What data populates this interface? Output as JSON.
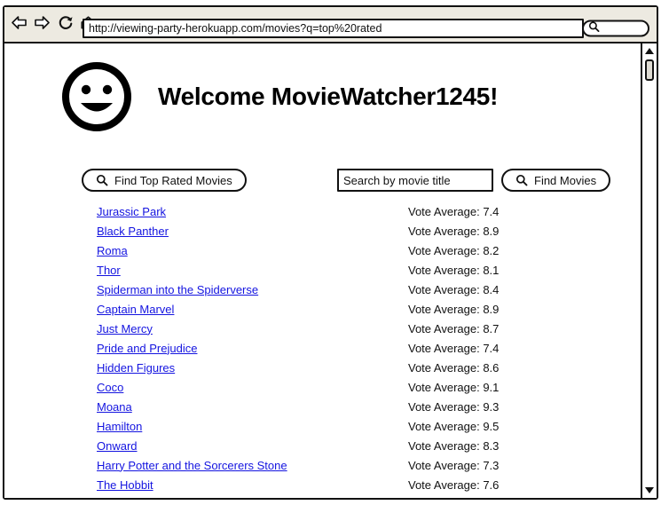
{
  "browser": {
    "back_icon": "back-arrow-icon",
    "forward_icon": "forward-arrow-icon",
    "reload_icon": "reload-icon",
    "home_icon": "home-icon",
    "url": "http://viewing-party-herokuapp.com/movies?q=top%20rated",
    "search_value": "",
    "search_placeholder": "",
    "search_icon": "search-icon"
  },
  "page": {
    "avatar_icon": "smiley-face-icon",
    "welcome_title": "Welcome MovieWatcher1245!"
  },
  "controls": {
    "top_rated_button": {
      "label": "Find Top Rated Movies",
      "icon": "search-icon"
    },
    "search_input": {
      "value": "",
      "placeholder": "Search by movie title"
    },
    "find_movies_button": {
      "label": "Find Movies",
      "icon": "search-icon"
    }
  },
  "colors": {
    "link": "#1414E0",
    "chrome_background": "#EDEAE1",
    "outline": "#111111",
    "page_background": "#FFFFFF"
  },
  "movies": [
    {
      "title": "Jurassic Park",
      "vote": "Vote Average: 7.4"
    },
    {
      "title": "Black Panther",
      "vote": "Vote Average: 8.9"
    },
    {
      "title": "Roma",
      "vote": "Vote Average: 8.2"
    },
    {
      "title": "Thor",
      "vote": "Vote Average: 8.1"
    },
    {
      "title": "Spiderman into the Spiderverse",
      "vote": "Vote Average: 8.4"
    },
    {
      "title": "Captain Marvel",
      "vote": "Vote Average: 8.9"
    },
    {
      "title": "Just Mercy",
      "vote": "Vote Average: 8.7"
    },
    {
      "title": "Pride and Prejudice",
      "vote": "Vote Average: 7.4"
    },
    {
      "title": "Hidden Figures",
      "vote": "Vote Average: 8.6"
    },
    {
      "title": "Coco",
      "vote": "Vote Average: 9.1"
    },
    {
      "title": "Moana",
      "vote": "Vote Average: 9.3"
    },
    {
      "title": "Hamilton",
      "vote": "Vote Average: 9.5"
    },
    {
      "title": "Onward",
      "vote": "Vote Average: 8.3"
    },
    {
      "title": "Harry Potter and the Sorcerers Stone",
      "vote": "Vote Average: 7.3"
    },
    {
      "title": "The Hobbit",
      "vote": "Vote Average: 7.6"
    }
  ],
  "scrollbar": {
    "up_icon": "triangle-up-icon",
    "down_icon": "triangle-down-icon"
  }
}
